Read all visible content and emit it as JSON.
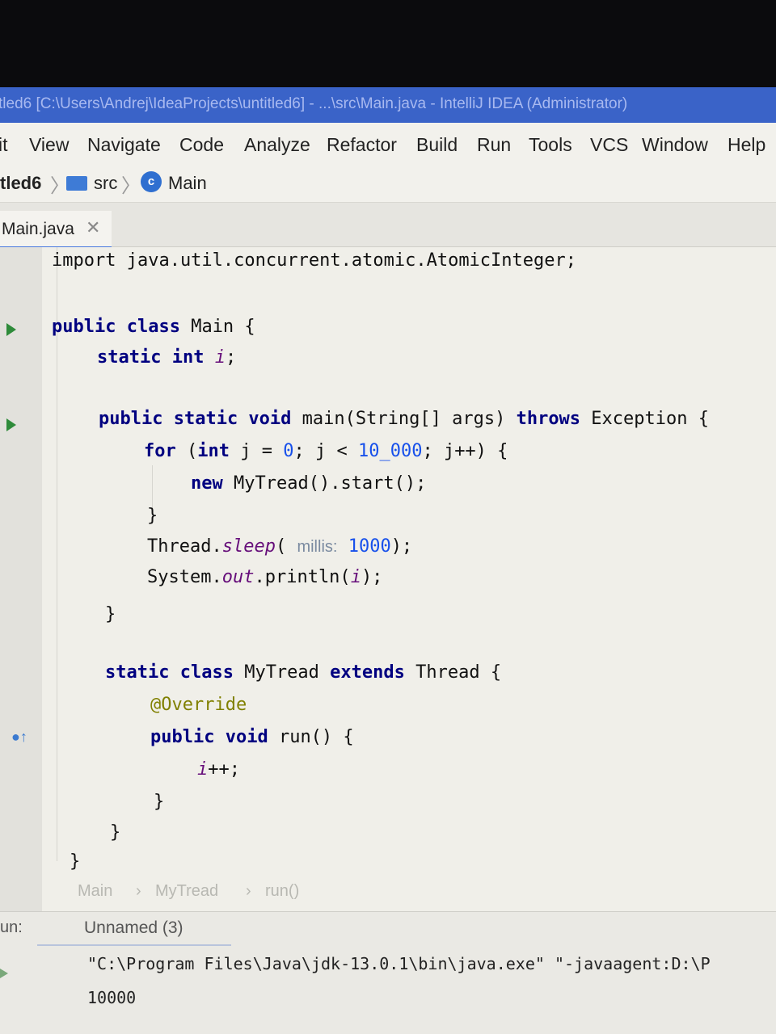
{
  "window": {
    "title": "tled6 [C:\\Users\\Andrej\\IdeaProjects\\untitled6] - ...\\src\\Main.java - IntelliJ IDEA (Administrator)"
  },
  "menu": {
    "items": [
      "it",
      "View",
      "Navigate",
      "Code",
      "Analyze",
      "Refactor",
      "Build",
      "Run",
      "Tools",
      "VCS",
      "Window",
      "Help"
    ]
  },
  "navbar": {
    "project": "tled6",
    "folder": "src",
    "class_icon_letter": "c",
    "class": "Main"
  },
  "tabs": {
    "active": "Main.java",
    "close": "✕"
  },
  "code": {
    "line1": "import java.util.concurrent.atomic.AtomicInteger;",
    "l2_kw": "public class",
    "l2_rest": " Main {",
    "l3_kw": "static int",
    "l3_var": "i",
    "l3_end": ";",
    "l4_kw": "public static void",
    "l4_rest": " main(String[] args) ",
    "l4_kw2": "throws",
    "l4_rest2": " Exception {",
    "l5_kw": "for",
    "l5_a": " (",
    "l5_kw2": "int",
    "l5_b": " j = ",
    "l5_n0": "0",
    "l5_c": "; j < ",
    "l5_n1": "10_000",
    "l5_d": "; j++) {",
    "l6_kw": "new",
    "l6_rest": " MyTread().start();",
    "l7": "}",
    "l8_a": "Thread.",
    "l8_m": "sleep",
    "l8_b": "( ",
    "l8_hint": "millis:",
    "l8_num": "1000",
    "l8_c": ");",
    "l9_a": "System.",
    "l9_f": "out",
    "l9_b": ".println(",
    "l9_v": "i",
    "l9_c": ");",
    "l10": "}",
    "l11_kw": "static class",
    "l11_a": " MyTread ",
    "l11_kw2": "extends",
    "l11_b": " Thread {",
    "l12": "@Override",
    "l13_kw": "public void",
    "l13_rest": " run() {",
    "l14_v": "i",
    "l14_rest": "++;",
    "l15": "}",
    "l16": "}",
    "l17": "}"
  },
  "breadcrumb": [
    "Main",
    "MyTread",
    "run()"
  ],
  "run_panel": {
    "label": "un:",
    "tab": "Unnamed (3)",
    "command": "\"C:\\Program Files\\Java\\jdk-13.0.1\\bin\\java.exe\" \"-javaagent:D:\\P",
    "output": "10000"
  }
}
